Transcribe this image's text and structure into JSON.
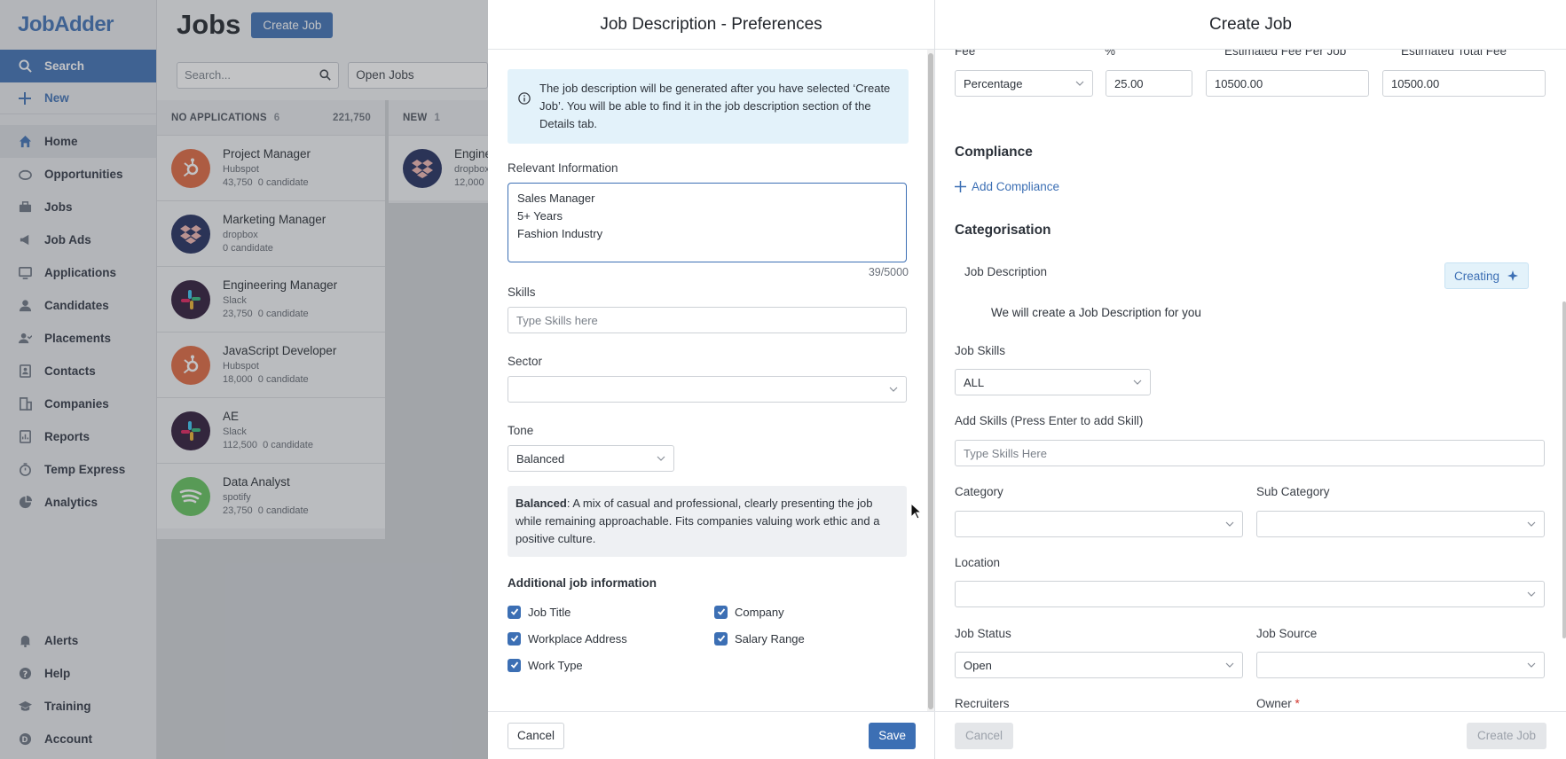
{
  "brand": {
    "name": "JobAdder"
  },
  "nav": {
    "search": "Search",
    "new": "New",
    "items": [
      {
        "label": "Home",
        "icon": "home-icon"
      },
      {
        "label": "Opportunities",
        "icon": "opportunities-icon"
      },
      {
        "label": "Jobs",
        "icon": "briefcase-icon"
      },
      {
        "label": "Job Ads",
        "icon": "megaphone-icon"
      },
      {
        "label": "Applications",
        "icon": "applications-icon"
      },
      {
        "label": "Candidates",
        "icon": "person-icon"
      },
      {
        "label": "Placements",
        "icon": "placements-icon"
      },
      {
        "label": "Contacts",
        "icon": "contacts-icon"
      },
      {
        "label": "Companies",
        "icon": "building-icon"
      },
      {
        "label": "Reports",
        "icon": "reports-icon"
      },
      {
        "label": "Temp Express",
        "icon": "stopwatch-icon"
      },
      {
        "label": "Analytics",
        "icon": "pie-chart-icon"
      }
    ],
    "bottom": [
      {
        "label": "Alerts",
        "icon": "bell-icon"
      },
      {
        "label": "Help",
        "icon": "help-icon"
      },
      {
        "label": "Training",
        "icon": "graduation-cap-icon"
      },
      {
        "label": "Account",
        "icon": "account-icon",
        "badge": "D"
      }
    ]
  },
  "jobs": {
    "title": "Jobs",
    "create_button": "Create Job",
    "search_placeholder": "Search...",
    "filter": "Open Jobs",
    "columns": [
      {
        "name": "NO APPLICATIONS",
        "count": "6",
        "total": "221,750",
        "cards": [
          {
            "title": "Project Manager",
            "company": "Hubspot",
            "amount": "43,750",
            "candidates": "0 candidate",
            "logo": "hubspot"
          },
          {
            "title": "Marketing Manager",
            "company": "dropbox",
            "amount": "",
            "candidates": "0 candidate",
            "logo": "dropbox"
          },
          {
            "title": "Engineering Manager",
            "company": "Slack",
            "amount": "23,750",
            "candidates": "0 candidate",
            "logo": "slack"
          },
          {
            "title": "JavaScript Developer",
            "company": "Hubspot",
            "amount": "18,000",
            "candidates": "0 candidate",
            "logo": "hubspot"
          },
          {
            "title": "AE",
            "company": "Slack",
            "amount": "112,500",
            "candidates": "0 candidate",
            "logo": "slack"
          },
          {
            "title": "Data Analyst",
            "company": "spotify",
            "amount": "23,750",
            "candidates": "0 candidate",
            "logo": "spotify"
          }
        ]
      },
      {
        "name": "NEW",
        "count": "1",
        "cards": [
          {
            "title": "Engine",
            "company": "dropbox",
            "amount": "12,000",
            "logo": "dropbox"
          }
        ]
      }
    ]
  },
  "preferences": {
    "title": "Job Description - Preferences",
    "info": "The job description will be generated after you have selected ‘Create Job’. You will be able to find it in the job description section of the Details tab.",
    "relevant_label": "Relevant Information",
    "relevant_value": "Sales Manager\n5+ Years\nFashion Industry",
    "counter": "39/5000",
    "skills_label": "Skills",
    "skills_placeholder": "Type Skills here",
    "sector_label": "Sector",
    "sector_value": "",
    "tone_label": "Tone",
    "tone_value": "Balanced",
    "tone_desc_bold": "Balanced",
    "tone_desc": ": A mix of casual and professional, clearly presenting the job while remaining approachable. Fits companies valuing work ethic and a positive culture.",
    "additional_label": "Additional job information",
    "checkboxes": [
      {
        "label": "Job Title",
        "checked": true
      },
      {
        "label": "Company",
        "checked": true
      },
      {
        "label": "Workplace Address",
        "checked": true
      },
      {
        "label": "Salary Range",
        "checked": true
      },
      {
        "label": "Work Type",
        "checked": true
      }
    ],
    "cancel": "Cancel",
    "save": "Save"
  },
  "create_job": {
    "title": "Create Job",
    "fee_label": "Fee",
    "pct_label": "%",
    "est_fee_label": "Estimated Fee Per Job",
    "est_total_label": "Estimated Total Fee",
    "fee_type": "Percentage",
    "pct_value": "25.00",
    "est_fee_value": "10500.00",
    "est_total_value": "10500.00",
    "compliance_heading": "Compliance",
    "add_compliance": "Add Compliance",
    "categorisation_heading": "Categorisation",
    "job_description_label": "Job Description",
    "creating_label": "Creating",
    "job_description_note": "We will create a Job Description for you",
    "job_skills_label": "Job Skills",
    "job_skills_value": "ALL",
    "add_skills_label": "Add Skills (Press Enter to add Skill)",
    "add_skills_placeholder": "Type Skills Here",
    "category_label": "Category",
    "subcategory_label": "Sub Category",
    "location_label": "Location",
    "job_status_label": "Job Status",
    "job_status_value": "Open",
    "job_source_label": "Job Source",
    "recruiters_label": "Recruiters",
    "owner_label": "Owner",
    "owner_required": "*",
    "cancel": "Cancel",
    "create": "Create Job"
  },
  "colors": {
    "primary": "#3c6fb4",
    "info_bg": "#e3f2fa",
    "sidebar_bg": "#e9ebee"
  }
}
